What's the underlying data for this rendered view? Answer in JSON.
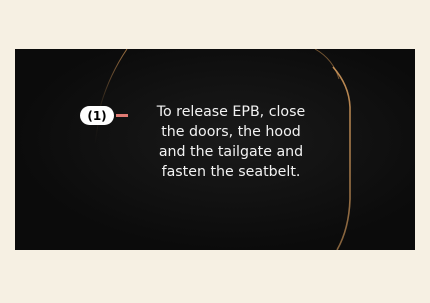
{
  "callout": {
    "label": "(1)"
  },
  "message": {
    "text": "To release EPB, close\nthe doors, the hood\nand the tailgate and\nfasten the seatbelt."
  },
  "colors": {
    "page_background": "#f6f0e3",
    "screen_background": "#0b0b0b",
    "frame_accent": "#c98f52",
    "callout_line": "#e07a73"
  }
}
